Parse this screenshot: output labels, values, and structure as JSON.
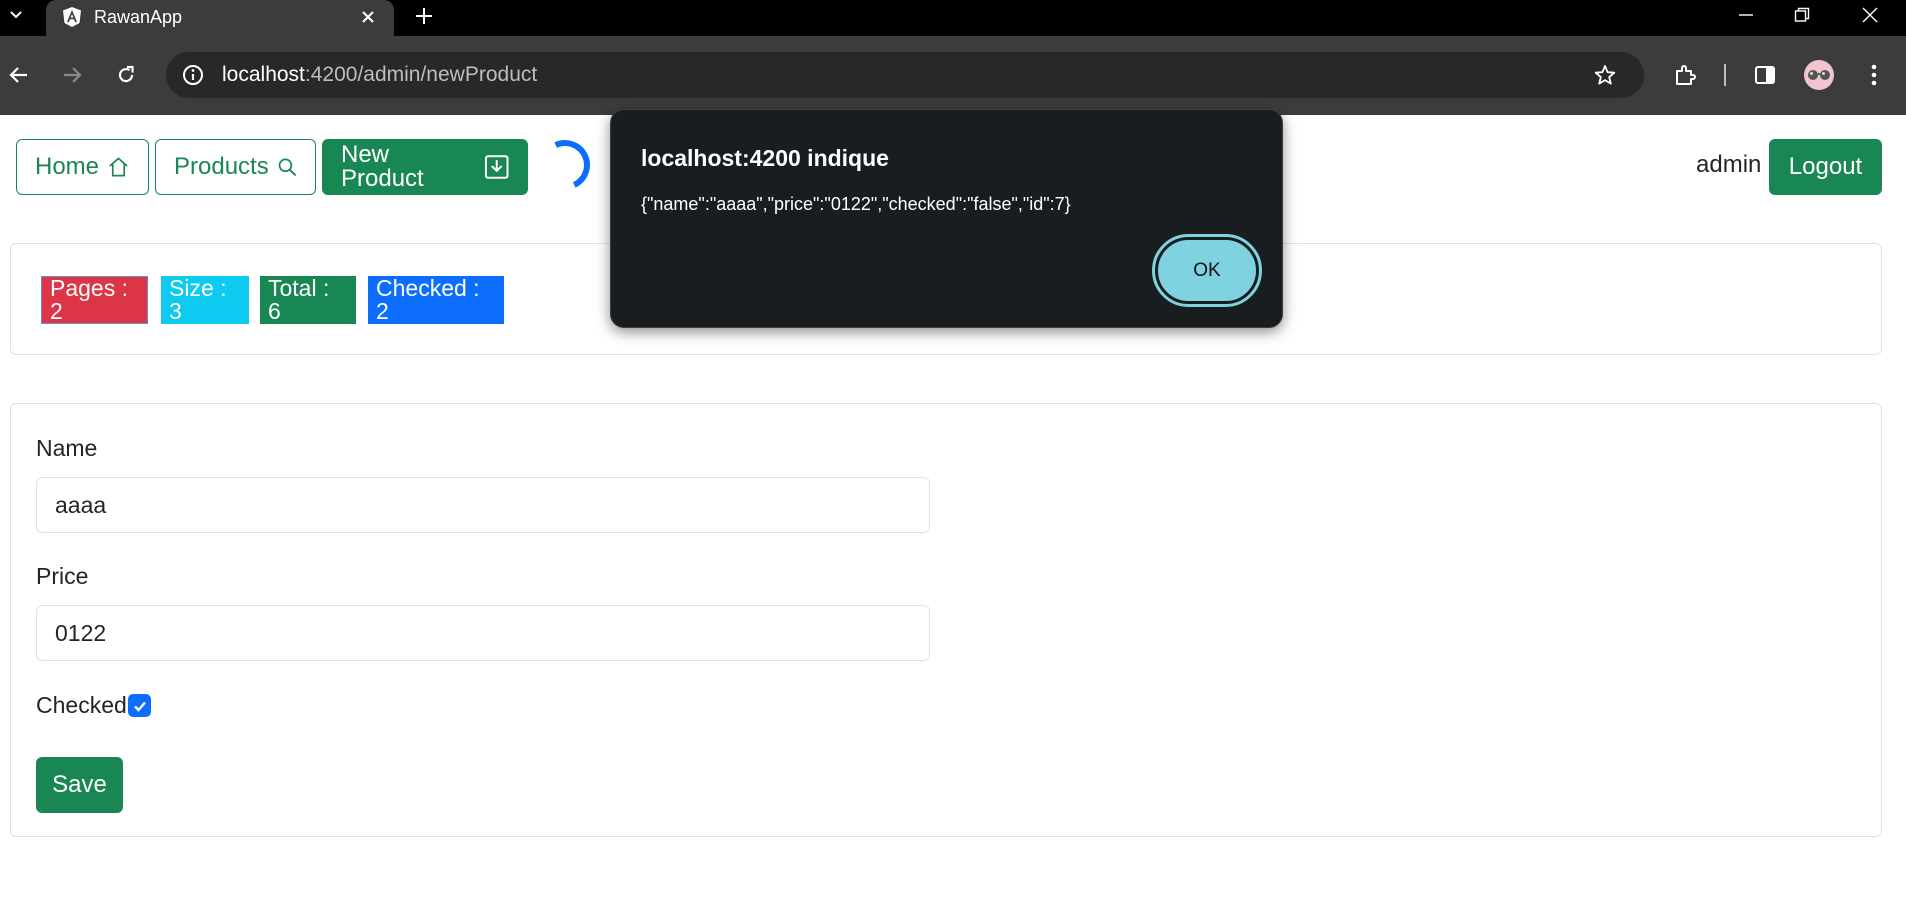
{
  "browser": {
    "tab_title": "RawanApp",
    "url_host": "localhost",
    "url_rest": ":4200/admin/newProduct"
  },
  "nav": {
    "home_label": "Home",
    "products_label": "Products",
    "new_product_label": "New Product",
    "user": "admin",
    "logout_label": "Logout"
  },
  "stats": {
    "pages": "Pages : 2",
    "size": "Size : 3",
    "total": "Total : 6",
    "checked": "Checked : 2"
  },
  "form": {
    "name_label": "Name",
    "name_value": "aaaa",
    "price_label": "Price",
    "price_value": "0122",
    "checked_label": "Checked",
    "checked_value": true,
    "save_label": "Save"
  },
  "dialog": {
    "title": "localhost:4200 indique",
    "message": "{\"name\":\"aaaa\",\"price\":\"0122\",\"checked\":\"false\",\"id\":7}",
    "ok_label": "OK"
  },
  "colors": {
    "success": "#198754",
    "danger": "#dc3545",
    "info": "#0dcaf0",
    "primary": "#0d6efd",
    "dialog_bg": "#191d1f",
    "ok_button": "#7fd3e0"
  },
  "icons": [
    "chevron-down-icon",
    "angular-logo-icon",
    "close-icon",
    "plus-icon",
    "minimize-icon",
    "restore-icon",
    "back-icon",
    "forward-icon",
    "reload-icon",
    "site-info-icon",
    "star-icon",
    "extensions-icon",
    "side-panel-icon",
    "avatar",
    "more-icon",
    "house-icon",
    "search-icon",
    "download-icon",
    "check-icon"
  ]
}
